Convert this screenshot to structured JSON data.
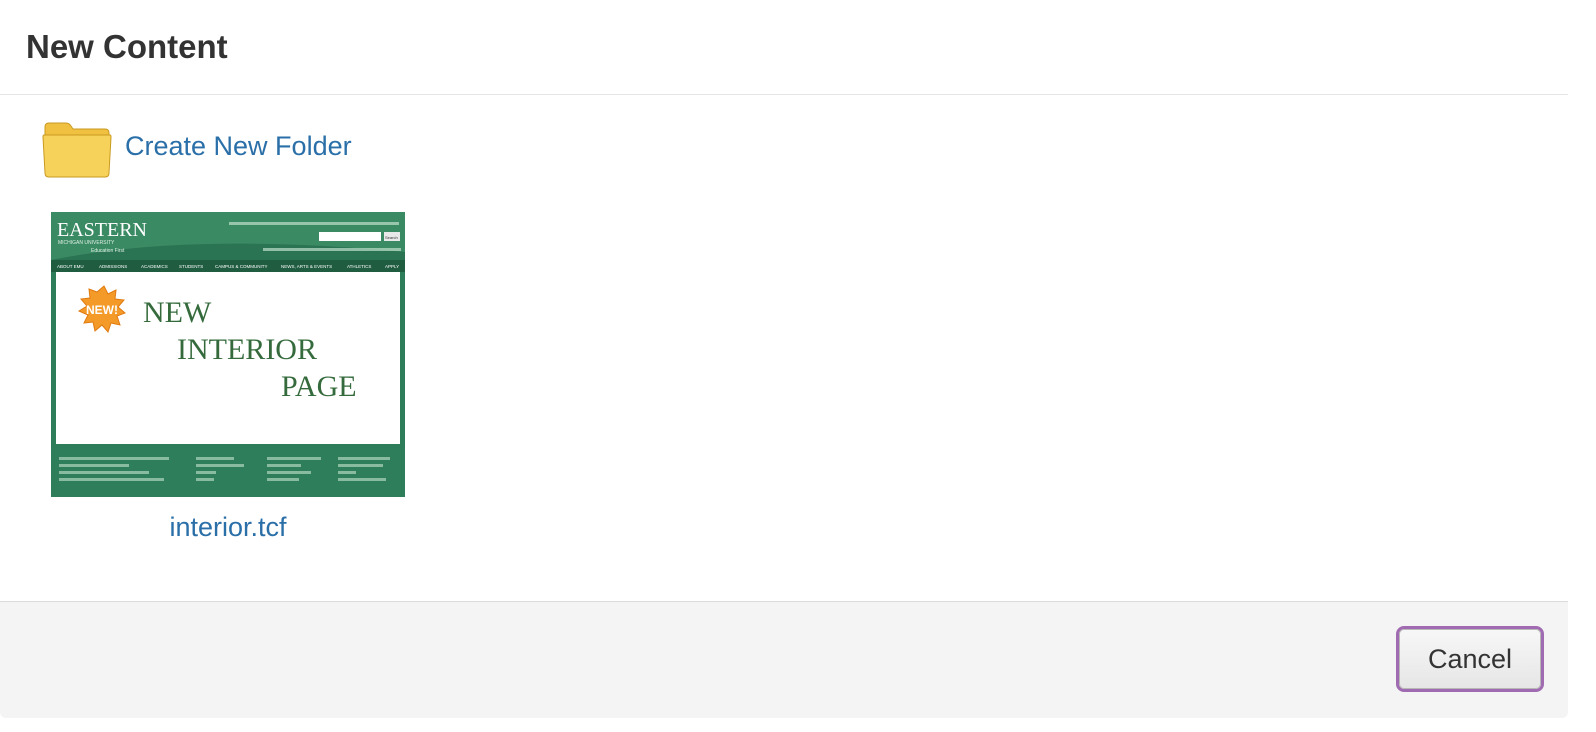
{
  "dialog": {
    "title": "New Content"
  },
  "body": {
    "create_folder_label": "Create New Folder",
    "templates": [
      {
        "name": "interior.tcf",
        "thumbnail": {
          "brand": "EASTERN",
          "brand_sub": "MICHIGAN UNIVERSITY",
          "tagline": "Education First",
          "badge": "NEW!",
          "headline": [
            "NEW",
            "INTERIOR",
            "PAGE"
          ],
          "nav": [
            "ABOUT EMU",
            "ADMISSIONS",
            "ACADEMICS",
            "STUDENTS",
            "CAMPUS & COMMUNITY",
            "NEWS, ARTS & EVENTS",
            "ATHLETICS",
            "APPLY"
          ],
          "search_button": "Search"
        }
      }
    ]
  },
  "footer": {
    "cancel_label": "Cancel"
  },
  "colors": {
    "link": "#2a6fa8",
    "title": "#333333",
    "focus_ring": "#a06bb0",
    "emu_green": "#2e7d5a",
    "folder_yellow": "#f5cc4c"
  }
}
